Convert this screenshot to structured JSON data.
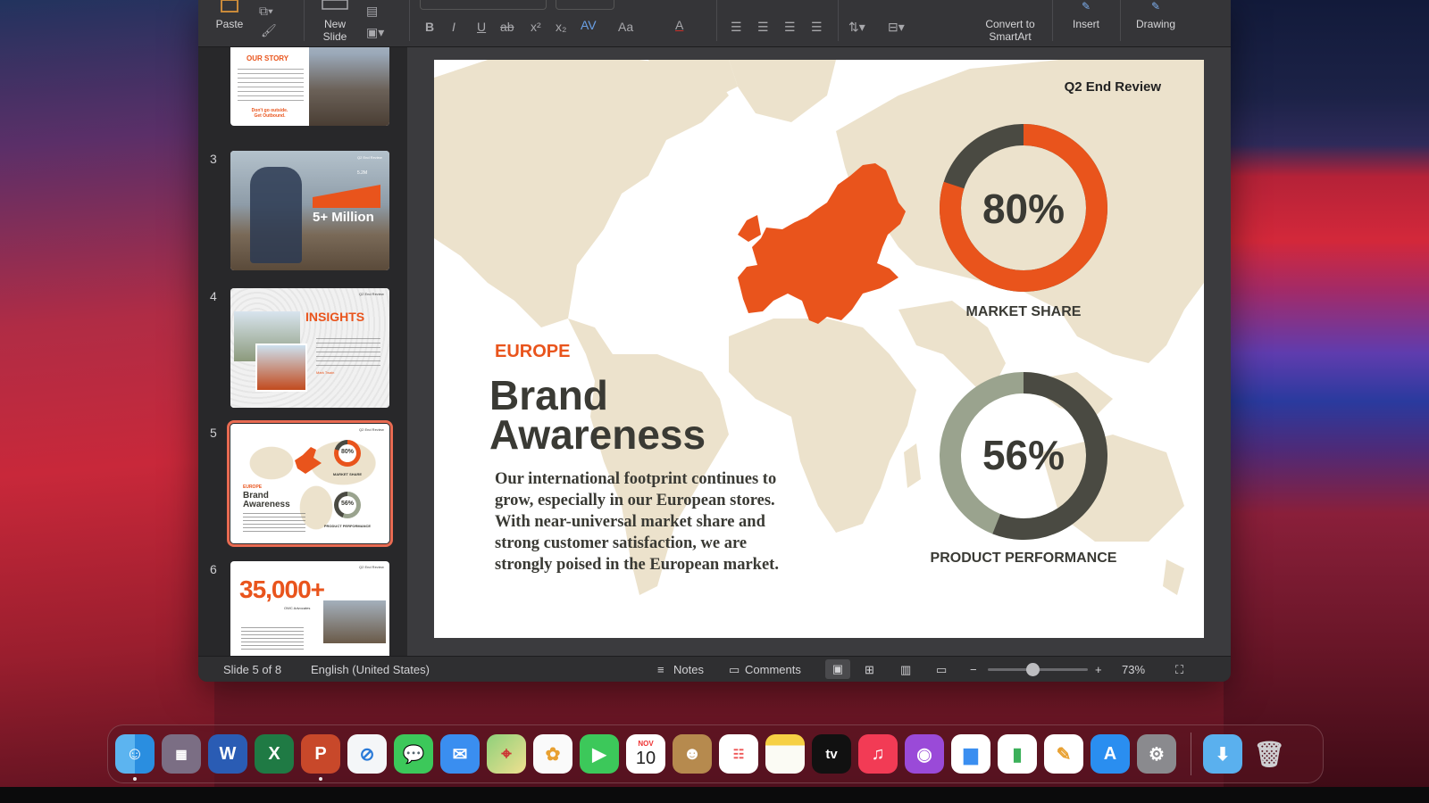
{
  "ribbon": {
    "paste_label": "Paste",
    "new_slide_label": "New\nSlide",
    "convert_label": "Convert to\nSmartArt",
    "insert_label": "Insert",
    "drawing_label": "Drawing",
    "font_buttons": [
      "B",
      "I",
      "U",
      "ab",
      "x²",
      "x₂",
      "AV",
      "Aa",
      "A"
    ]
  },
  "thumbnails": {
    "t2": {
      "heading": "OUR STORY",
      "footer": "Don't go outside.\nGet Outbound."
    },
    "t3": {
      "num": "3",
      "stat": "5+ Million",
      "chip": "5.2M",
      "corner": "Q2 End Review"
    },
    "t4": {
      "num": "4",
      "heading": "INSIGHTS",
      "corner": "Q2 End Review",
      "author": "Mark Twain"
    },
    "t5": {
      "num": "5",
      "europe": "EUROPE",
      "title1": "Brand",
      "title2": "Awareness",
      "pct1": "80%",
      "label1": "MARKET SHARE",
      "pct2": "56%",
      "label2": "PRODUCT PERFORMANCE",
      "corner": "Q2 End Review"
    },
    "t6": {
      "num": "6",
      "big": "35,000+",
      "sub": "OWC Advocates",
      "corner": "Q2 End Review"
    }
  },
  "slide": {
    "header": "Q2 End Review",
    "region": "EUROPE",
    "title_line1": "Brand",
    "title_line2": "Awareness",
    "body_lines": [
      "Our international footprint continues to",
      "grow, especially in our European stores.",
      "With near-universal market share and",
      "strong customer satisfaction, we are",
      "strongly poised in the European market."
    ],
    "donut1": {
      "value": 80,
      "label_text": "80%",
      "caption": "MARKET SHARE",
      "fill_color": "#e9541c",
      "rest_color": "#4a4a42"
    },
    "donut2": {
      "value": 56,
      "label_text": "56%",
      "caption": "PRODUCT PERFORMANCE",
      "fill_color": "#4a4a42",
      "rest_color": "#9aa38e"
    },
    "colors": {
      "accent": "#e9541c",
      "map": "#ece2cc",
      "text": "#3a3a34"
    }
  },
  "status": {
    "slide_info": "Slide 5 of 8",
    "language": "English (United States)",
    "notes": "Notes",
    "comments": "Comments",
    "zoom": "73%",
    "zoom_level": 0.45
  },
  "dock": {
    "calendar_month": "NOV",
    "calendar_day": "10",
    "tv_label": "tv",
    "apps": [
      "Finder",
      "Launchpad",
      "Word",
      "Excel",
      "PowerPoint",
      "Safari",
      "Messages",
      "Mail",
      "Maps",
      "Photos",
      "FaceTime",
      "Calendar",
      "Contacts",
      "Reminders",
      "Notes",
      "TV",
      "Music",
      "Podcasts",
      "Keynote",
      "Numbers",
      "Pages",
      "App Store",
      "System Preferences",
      "Downloads",
      "Trash"
    ]
  }
}
